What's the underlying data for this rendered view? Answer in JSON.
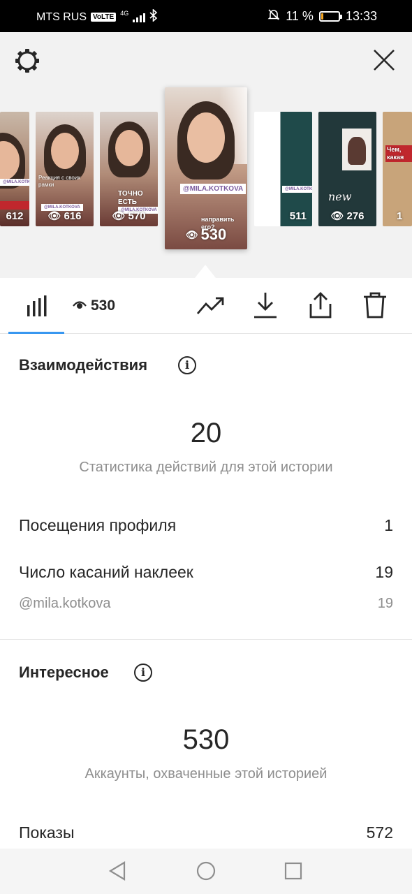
{
  "status_bar": {
    "carrier": "MTS RUS",
    "volte": "VoLTE",
    "network": "4G",
    "battery_text": "11 %",
    "battery_level": 0.11,
    "time": "13:33"
  },
  "stories": [
    {
      "views": "612",
      "tag": "@MILA.KOTKOVA"
    },
    {
      "views": "616",
      "tag": "@MILA.KOTKOVA"
    },
    {
      "views": "570",
      "tag": "@MILA.KOTKOVA",
      "caption": "ТОЧНО ЕСТЬ"
    },
    {
      "views": "530",
      "tag": "@MILA.KOTKOVA",
      "caption": "направить его?",
      "selected": true
    },
    {
      "views": "511",
      "tag": "@MILA.KOTKOVA"
    },
    {
      "views": "276",
      "caption": "new"
    },
    {
      "views": "1",
      "caption": "Чем, какая"
    }
  ],
  "toolbar": {
    "views": "530",
    "icons": [
      "bar-chart-icon",
      "eye-icon",
      "trend-icon",
      "download-icon",
      "share-icon",
      "trash-icon"
    ]
  },
  "interactions": {
    "title": "Взаимодействия",
    "total": "20",
    "total_label": "Статистика действий для этой истории",
    "rows": [
      {
        "label": "Посещения профиля",
        "value": "1"
      },
      {
        "label": "Число касаний наклеек",
        "value": "19"
      }
    ],
    "sub_rows": [
      {
        "label": "@mila.kotkova",
        "value": "19"
      }
    ]
  },
  "discovery": {
    "title": "Интересное",
    "total": "530",
    "total_label": "Аккаунты, охваченные этой историей",
    "rows": [
      {
        "label": "Показы",
        "value": "572"
      }
    ]
  },
  "colors": {
    "accent": "#3897f0",
    "text": "#262626",
    "muted": "#8e8e8e",
    "battery": "#f5a623"
  }
}
